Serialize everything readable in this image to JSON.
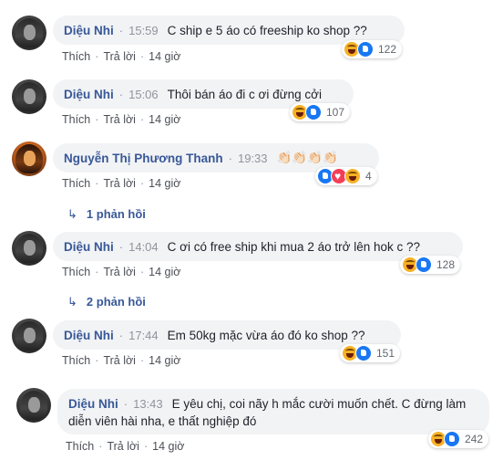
{
  "common": {
    "sep": "·",
    "like": "Thích",
    "reply": "Trả lời",
    "dot": "·"
  },
  "comments": [
    {
      "name": "Diệu Nhi",
      "time": "15:59",
      "text": "C ship e 5 áo có freeship ko shop ??",
      "ago": "14 giờ",
      "reacts": "122"
    },
    {
      "name": "Diệu Nhi",
      "time": "15:06",
      "text": "Thôi bán áo đi c ơi đừng cởi",
      "ago": "14 giờ",
      "reacts": "107"
    },
    {
      "name": "Nguyễn Thị Phương Thanh",
      "time": "19:33",
      "text": "👏🏻👏🏻👏🏻👏🏻",
      "ago": "14 giờ",
      "reacts": "4",
      "replies": "1 phản hồi"
    },
    {
      "name": "Diệu Nhi",
      "time": "14:04",
      "text": "C ơi có free ship khi mua 2 áo trở lên hok c ??",
      "ago": "14 giờ",
      "reacts": "128",
      "replies": "2 phản hồi"
    },
    {
      "name": "Diệu Nhi",
      "time": "17:44",
      "text": "Em 50kg mặc vừa áo đó ko shop ??",
      "ago": "14 giờ",
      "reacts": "151"
    },
    {
      "name": "Diệu Nhi",
      "time": "13:43",
      "text": "E yêu chị, coi nãy h mắc cười muốn chết. C đừng làm diễn viên hài nha, e thất nghiệp đó",
      "ago": "14 giờ",
      "reacts": "242"
    }
  ],
  "icons": {
    "haha": "haha-reaction-icon",
    "like": "like-reaction-icon",
    "love": "love-reaction-icon",
    "reply_arrow": "reply-arrow-icon"
  }
}
